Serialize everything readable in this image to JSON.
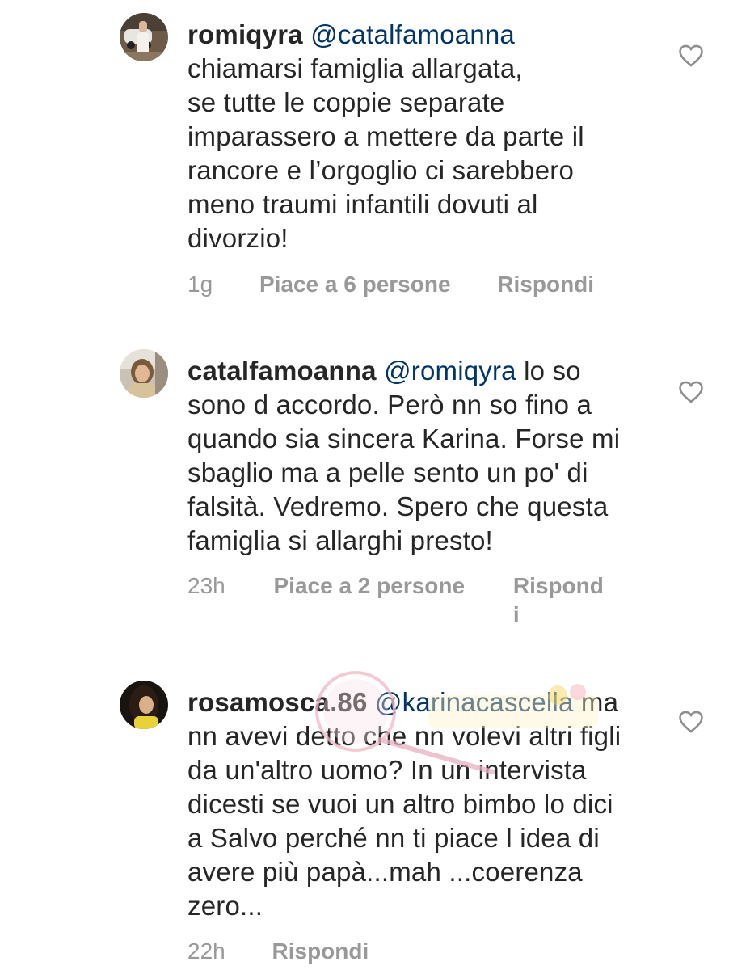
{
  "comments": [
    {
      "username": "romiqyra",
      "mention": "@catalfamoanna",
      "text_lines": [
        "chiamarsi famiglia allargata,",
        "se tutte le coppie separate",
        "imparassero a mettere da parte il",
        "rancore e l’orgoglio ci sarebbero",
        "meno traumi infantili dovuti al",
        "divorzio!"
      ],
      "time": "1g",
      "likes": "Piace a 6 persone",
      "reply": "Rispondi"
    },
    {
      "username": "catalfamoanna",
      "mention": "@romiqyra",
      "first_line_rest": "lo so",
      "text_lines": [
        "sono d accordo. Però nn so fino a",
        "quando sia sincera Karina. Forse mi",
        "sbaglio ma a pelle sento un po' di",
        "falsità. Vedremo. Spero che questa",
        "famiglia si allarghi presto!"
      ],
      "time": "23h",
      "likes": "Piace a 2 persone",
      "reply_line1": "Rispond",
      "reply_line2": "i"
    },
    {
      "username": "rosamosca.86",
      "mention": "@karinacascella",
      "first_line_rest": "ma",
      "text_lines": [
        "nn avevi detto che nn volevi altri figli",
        "da un'altro uomo? In un intervista",
        "dicesti se vuoi un altro bimbo lo dici",
        "a Salvo perché nn ti piace l idea di",
        "avere più papà...mah ...coerenza",
        "zero..."
      ],
      "time": "22h",
      "reply": "Rispondi"
    }
  ],
  "colors": {
    "text": "#262626",
    "mention": "#003569",
    "meta": "#999999",
    "heart": "#8e8e8e"
  },
  "icons": [
    "heart-icon",
    "avatar"
  ]
}
